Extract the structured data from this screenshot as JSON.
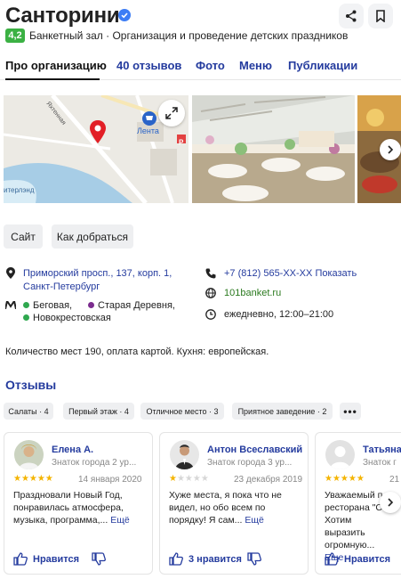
{
  "header": {
    "title": "Санторини",
    "verified_icon": "verified-check-icon",
    "share_icon": "share-icon",
    "bookmark_icon": "bookmark-icon",
    "rating": "4,2",
    "rating_color": "#3bb143",
    "categories": "Банкетный зал · Организация и проведение детских праздников"
  },
  "tabs": [
    {
      "label": "Про организацию",
      "active": true
    },
    {
      "label": "40 отзывов"
    },
    {
      "label": "Фото"
    },
    {
      "label": "Меню"
    },
    {
      "label": "Публикации"
    }
  ],
  "map": {
    "labels": {
      "street": "Яхтенная",
      "place": "Лента",
      "place2": "итерлэнд"
    },
    "pin_color": "#e21f26"
  },
  "actions": {
    "site": "Сайт",
    "route": "Как добраться"
  },
  "info": {
    "address": "Приморский просп., 137, корп. 1, Санкт-Петербург",
    "metro": [
      {
        "name": "Беговая,",
        "color": "#2fa84f"
      },
      {
        "name": "Старая Деревня,",
        "color": "#7b2c8e"
      },
      {
        "name": "Новокрестовская",
        "color": "#2fa84f"
      }
    ],
    "phone": "+7 (812) 565-XX-XX",
    "phone_action": "Показать",
    "website": "101banket.ru",
    "hours": "ежедневно, 12:00–21:00"
  },
  "description": "Количество мест 190, оплата картой. Кухня: европейская.",
  "reviews": {
    "heading": "Отзывы",
    "chips": [
      "Салаты · 4",
      "Первый этаж · 4",
      "Отличное место · 3",
      "Приятное заведение · 2",
      "•••"
    ],
    "cards": [
      {
        "name": "Елена А.",
        "level": "Знаток города 2 ур...",
        "rating": 5,
        "date": "14 января 2020",
        "text": "Праздновали Новый Год, понравилась атмосфера, музыка, программа,...",
        "more": "Ещё",
        "like": "Нравится"
      },
      {
        "name": "Антон Всеславский",
        "level": "Знаток города 3 ур...",
        "rating": 1,
        "date": "23 декабря 2019",
        "text": "Хуже места, я пока что не видел, но обо всем по порядку! Я сам...",
        "more": "Ещё",
        "like": "3 нравится"
      },
      {
        "name": "Татьяна",
        "level": "Знаток г",
        "rating": 5,
        "date": "21 я",
        "text": "Уважаемый п ресторана \"С Хотим выразить огромную...",
        "more": "Еще",
        "like": "Нравится"
      }
    ]
  }
}
